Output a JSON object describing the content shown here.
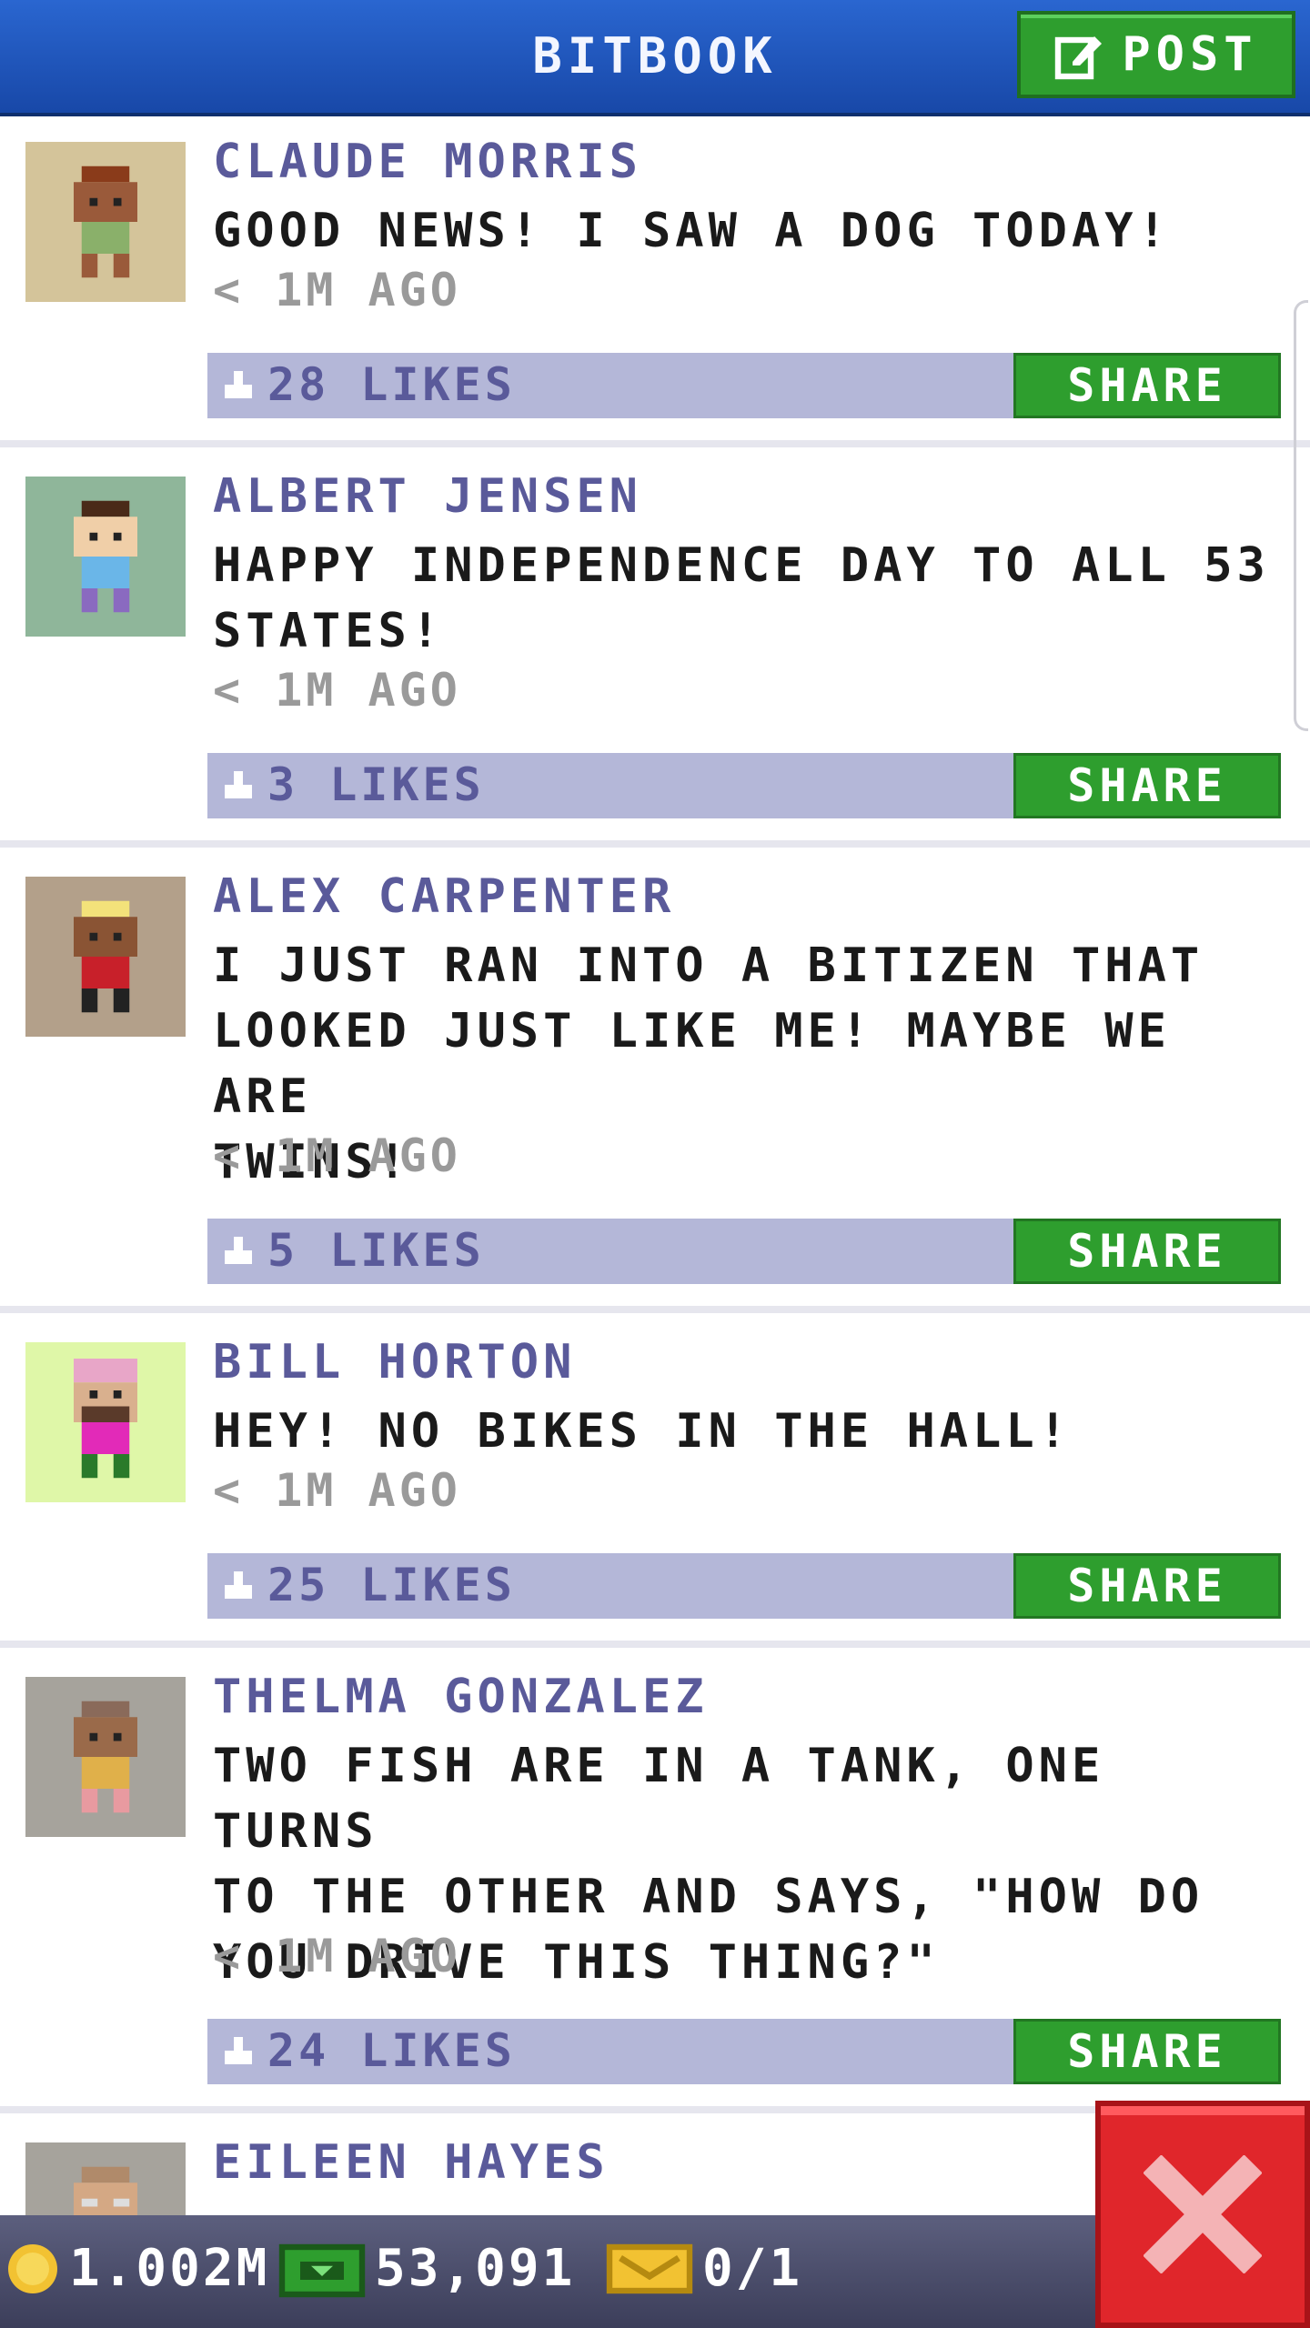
{
  "header": {
    "title": "BITBOOK",
    "post_label": "POST"
  },
  "posts": [
    {
      "author": "CLAUDE MORRIS",
      "text": "GOOD NEWS! I SAW A DOG TODAY!",
      "time": "< 1M AGO",
      "likes": "28 LIKES",
      "share_label": "SHARE",
      "avatar_bg": "#d4c49a"
    },
    {
      "author": "ALBERT JENSEN",
      "text": "HAPPY INDEPENDENCE DAY TO ALL 53\nSTATES!",
      "time": "< 1M AGO",
      "likes": "3 LIKES",
      "share_label": "SHARE",
      "avatar_bg": "#8fb69a"
    },
    {
      "author": "ALEX CARPENTER",
      "text": "I JUST RAN INTO A BITIZEN THAT\nLOOKED JUST LIKE ME! MAYBE WE ARE\nTWINS!",
      "time": "< 1M AGO",
      "likes": "5 LIKES",
      "share_label": "SHARE",
      "avatar_bg": "#b3a08a"
    },
    {
      "author": "BILL HORTON",
      "text": "HEY! NO BIKES IN THE HALL!",
      "time": "< 1M AGO",
      "likes": "25 LIKES",
      "share_label": "SHARE",
      "avatar_bg": "#dff7a8"
    },
    {
      "author": "THELMA GONZALEZ",
      "text": "TWO FISH ARE IN A TANK, ONE TURNS\nTO THE OTHER AND SAYS, \"HOW DO\nYOU DRIVE THIS THING?\"",
      "time": "< 1M AGO",
      "likes": "24 LIKES",
      "share_label": "SHARE",
      "avatar_bg": "#a6a39c"
    },
    {
      "author": "EILEEN HAYES",
      "text": "",
      "time": "",
      "likes": "",
      "share_label": "",
      "avatar_bg": "#a6a39c"
    }
  ],
  "status": {
    "coins": "1.002M",
    "bux": "53,091",
    "tickets": "0/1"
  },
  "colors": {
    "header": "#1f54b8",
    "share": "#2e9e2e",
    "like_bar": "#b4b7d8",
    "close": "#e0262b"
  }
}
